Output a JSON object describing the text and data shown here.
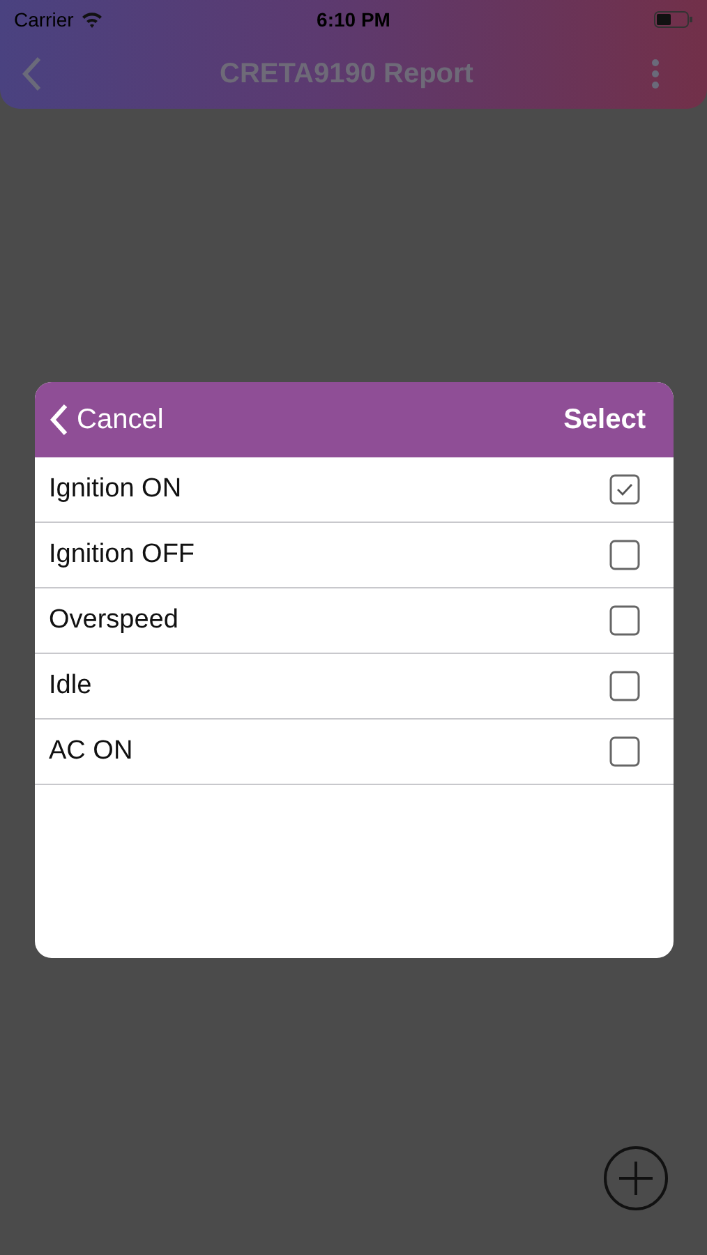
{
  "status_bar": {
    "carrier": "Carrier",
    "time": "6:10 PM"
  },
  "nav_bar": {
    "title": "CRETA9190 Report"
  },
  "dialog": {
    "cancel": "Cancel",
    "confirm": "Select",
    "options": [
      {
        "label": "Ignition ON",
        "checked": true
      },
      {
        "label": "Ignition OFF",
        "checked": false
      },
      {
        "label": "Overspeed",
        "checked": false
      },
      {
        "label": "Idle",
        "checked": false
      },
      {
        "label": "AC ON",
        "checked": false
      }
    ]
  }
}
